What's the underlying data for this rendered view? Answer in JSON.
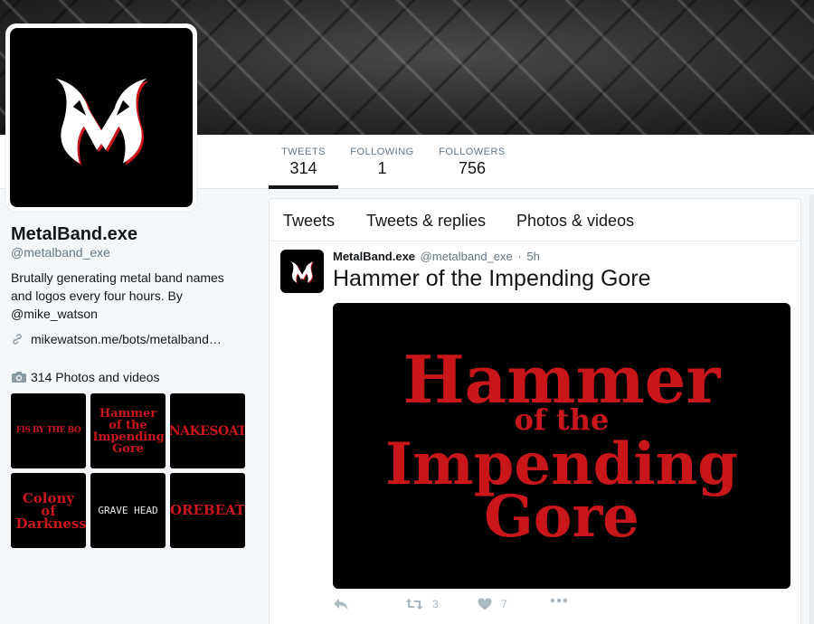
{
  "profile": {
    "name": "MetalBand.exe",
    "handle": "@metalband_exe",
    "bio": "Brutally generating metal band names and logos every four hours. By @mike_watson",
    "link": "mikewatson.me/bots/metalband…",
    "link_icon": "link-icon",
    "avatar_icon": "metal-m-logo-icon"
  },
  "stats": {
    "tweets": {
      "label": "TWEETS",
      "value": "314"
    },
    "following": {
      "label": "FOLLOWING",
      "value": "1"
    },
    "followers": {
      "label": "FOLLOWERS",
      "value": "756"
    }
  },
  "photos": {
    "header": "314 Photos and videos",
    "camera_icon": "camera-icon",
    "thumbs": [
      {
        "text": "FIS BY THE BO"
      },
      {
        "text": "Hammer of the Impending Gore"
      },
      {
        "text": "NAKESOAT"
      },
      {
        "text": "Colony of Darkness"
      },
      {
        "text": "GRAVE HEAD"
      },
      {
        "text": "OREBEAT"
      }
    ]
  },
  "tabs": {
    "tweets": "Tweets",
    "replies": "Tweets & replies",
    "media": "Photos & videos"
  },
  "tweet": {
    "name": "MetalBand.exe",
    "handle": "@metalband_exe",
    "separator": "·",
    "time": "5h",
    "text": "Hammer of the Impending Gore",
    "image_lines": [
      "Hammer",
      "of the",
      "Impending",
      "Gore"
    ],
    "retweets": "3",
    "likes": "7"
  },
  "colors": {
    "logo_red": "#c8161b",
    "text_gray": "#657786",
    "action_gray": "#aab8c2"
  }
}
